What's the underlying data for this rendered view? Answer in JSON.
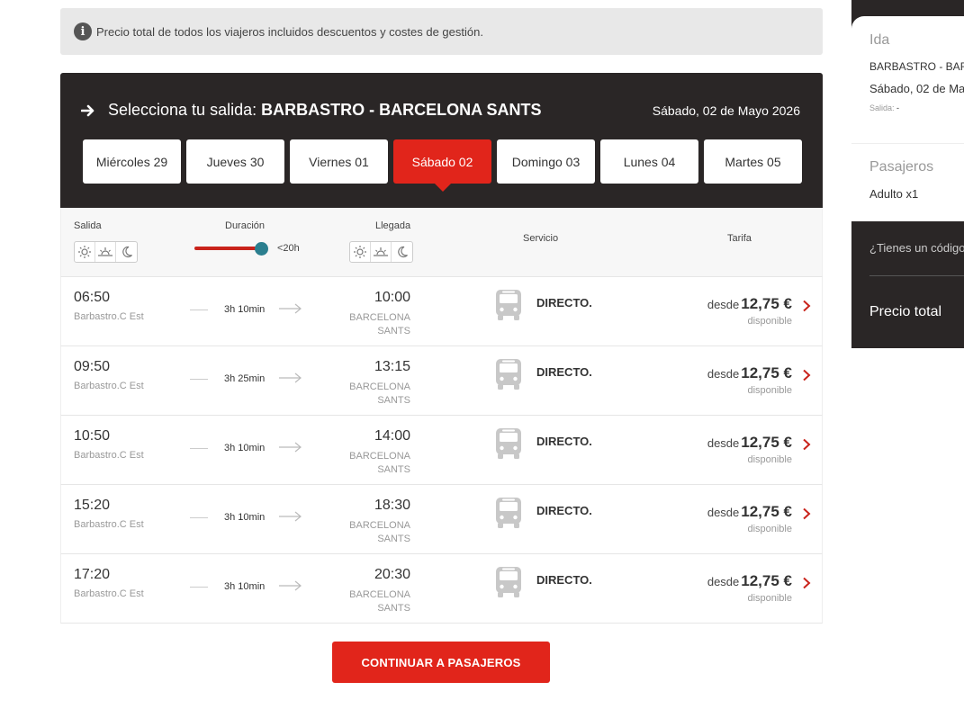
{
  "notice": {
    "text": "Precio total de todos los viajeros incluidos descuentos y costes de gestión."
  },
  "header": {
    "title_prefix": "Selecciona tu salida:",
    "route": "BARBASTRO - BARCELONA SANTS",
    "date": "Sábado, 02 de Mayo 2026"
  },
  "days": [
    {
      "label": "Miércoles 29"
    },
    {
      "label": "Jueves 30"
    },
    {
      "label": "Viernes 01"
    },
    {
      "label": "Sábado 02"
    },
    {
      "label": "Domingo 03"
    },
    {
      "label": "Lunes 04"
    },
    {
      "label": "Martes 05"
    }
  ],
  "active_day": 3,
  "filters": {
    "salida": "Salida",
    "duracion": "Duración",
    "duracion_value": "<20h",
    "llegada": "Llegada",
    "servicio": "Servicio",
    "tarifa": "Tarifa",
    "duration_slider_fraction": 1.0
  },
  "trips": [
    {
      "dep": "06:50",
      "dep_stop": "Barbastro.C Est",
      "duration": "3h 10min",
      "arr": "10:00",
      "arr_stop": "BARCELONA SANTS",
      "service": "DIRECTO.",
      "desde": "desde",
      "price": "12,75 €",
      "avail": "disponible"
    },
    {
      "dep": "09:50",
      "dep_stop": "Barbastro.C Est",
      "duration": "3h 25min",
      "arr": "13:15",
      "arr_stop": "BARCELONA SANTS",
      "service": "DIRECTO.",
      "desde": "desde",
      "price": "12,75 €",
      "avail": "disponible"
    },
    {
      "dep": "10:50",
      "dep_stop": "Barbastro.C Est",
      "duration": "3h 10min",
      "arr": "14:00",
      "arr_stop": "BARCELONA SANTS",
      "service": "DIRECTO.",
      "desde": "desde",
      "price": "12,75 €",
      "avail": "disponible"
    },
    {
      "dep": "15:20",
      "dep_stop": "Barbastro.C Est",
      "duration": "3h 10min",
      "arr": "18:30",
      "arr_stop": "BARCELONA SANTS",
      "service": "DIRECTO.",
      "desde": "desde",
      "price": "12,75 €",
      "avail": "disponible"
    },
    {
      "dep": "17:20",
      "dep_stop": "Barbastro.C Est",
      "duration": "3h 10min",
      "arr": "20:30",
      "arr_stop": "BARCELONA SANTS",
      "service": "DIRECTO.",
      "desde": "desde",
      "price": "12,75 €",
      "avail": "disponible"
    }
  ],
  "continue_label": "CONTINUAR A PASAJEROS",
  "sidebar": {
    "ida": "Ida",
    "route": "BARBASTRO - BAR",
    "date": "Sábado, 02 de Ma",
    "salida_label": "Salida:",
    "salida_value": "-",
    "pasajeros": "Pasajeros",
    "adult": "Adulto x1",
    "code": "¿Tienes un código",
    "total": "Precio total"
  },
  "colors": {
    "accent": "#e1251b",
    "dark": "#2a2626",
    "slider_knob": "#2b7f8f"
  },
  "icons": [
    "info-icon",
    "arrow-right-icon",
    "sun-icon",
    "sunrise-icon",
    "moon-icon",
    "bus-icon",
    "chevron-right-icon"
  ]
}
